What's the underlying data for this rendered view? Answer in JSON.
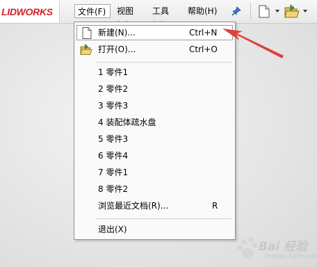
{
  "app": {
    "logo_text": "LIDWORKS"
  },
  "menubar": [
    {
      "id": "file",
      "label": "文件(F)"
    },
    {
      "id": "view",
      "label": "视图(V)"
    },
    {
      "id": "tools",
      "label": "工具(T)"
    },
    {
      "id": "help",
      "label": "帮助(H)"
    }
  ],
  "toolbar_icons": [
    "pin-icon",
    "new-document-icon",
    "open-folder-icon"
  ],
  "file_menu": {
    "new": {
      "label": "新建(N)...",
      "shortcut": "Ctrl+N"
    },
    "open": {
      "label": "打开(O)...",
      "shortcut": "Ctrl+O"
    },
    "recent": [
      "1 零件1",
      "2 零件2",
      "3 零件3",
      "4 装配体疏水盘",
      "5 零件3",
      "6 零件4",
      "7 零件1",
      "8 零件2"
    ],
    "browse_recent": {
      "label": "浏览最近文档(R)...",
      "shortcut": "R"
    },
    "exit": {
      "label": "退出(X)"
    }
  },
  "annotation": {
    "arrow_color": "#e0413b"
  },
  "watermark": {
    "text": "Bai 经验",
    "sub": "jingyan.baidu.com"
  },
  "colors": {
    "brand": "#d2232a",
    "accent": "#1a5fb4"
  }
}
